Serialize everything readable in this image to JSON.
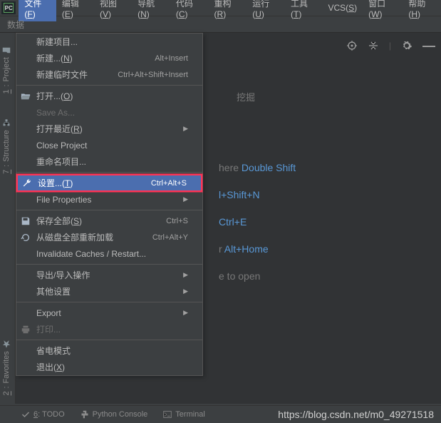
{
  "menubar": {
    "items": [
      {
        "label": "文件",
        "mn": "F"
      },
      {
        "label": "编辑",
        "mn": "E"
      },
      {
        "label": "视图",
        "mn": "V"
      },
      {
        "label": "导航",
        "mn": "N"
      },
      {
        "label": "代码",
        "mn": "C"
      },
      {
        "label": "重构",
        "mn": "R"
      },
      {
        "label": "运行",
        "mn": "U"
      },
      {
        "label": "工具",
        "mn": "T"
      },
      {
        "label": "VCS",
        "mn": "S"
      },
      {
        "label": "窗口",
        "mn": "W"
      },
      {
        "label": "帮助",
        "mn": "H"
      }
    ]
  },
  "subbar": {
    "text": "数据"
  },
  "sidetabs": {
    "project": {
      "num": "1",
      "label": "Project"
    },
    "structure": {
      "num": "7",
      "label": "Structure"
    },
    "favorites": {
      "num": "2",
      "label": "Favorites"
    }
  },
  "dropdown": {
    "items": [
      {
        "label": "新建项目...",
        "shortcut": "",
        "icon": "",
        "submenu": false
      },
      {
        "label": "新建...",
        "mn": "N",
        "shortcut": "Alt+Insert",
        "icon": "",
        "submenu": false
      },
      {
        "label": "新建临时文件",
        "shortcut": "Ctrl+Alt+Shift+Insert",
        "icon": "",
        "submenu": false
      },
      {
        "sep": true
      },
      {
        "label": "打开...",
        "mn": "O",
        "shortcut": "",
        "icon": "folder",
        "submenu": false
      },
      {
        "label": "Save As...",
        "disabled": true
      },
      {
        "label": "打开最近",
        "mn": "R",
        "shortcut": "",
        "submenu": true
      },
      {
        "label": "Close Project"
      },
      {
        "label": "重命名项目..."
      },
      {
        "sep": true
      },
      {
        "label": "设置...",
        "mn": "T",
        "shortcut": "Ctrl+Alt+S",
        "icon": "wrench",
        "highlighted": true
      },
      {
        "label": "File Properties",
        "submenu": true
      },
      {
        "sep": true
      },
      {
        "label": "保存全部",
        "mn": "S",
        "shortcut": "Ctrl+S",
        "icon": "save"
      },
      {
        "label": "从磁盘全部重新加载",
        "shortcut": "Ctrl+Alt+Y",
        "icon": "reload"
      },
      {
        "label": "Invalidate Caches / Restart..."
      },
      {
        "sep": true
      },
      {
        "label": "导出/导入操作",
        "submenu": true
      },
      {
        "label": "其他设置",
        "submenu": true
      },
      {
        "sep": true
      },
      {
        "label": "Export",
        "submenu": true
      },
      {
        "label": "打印...",
        "icon": "print",
        "disabled": true
      },
      {
        "sep": true
      },
      {
        "label": "省电模式"
      },
      {
        "label": "退出",
        "mn": "X"
      }
    ]
  },
  "editor_tip_fragment": "挖掘",
  "editor_hints": [
    {
      "pre": "here  ",
      "link": "Double Shift"
    },
    {
      "pre": "",
      "link": "l+Shift+N"
    },
    {
      "pre": "",
      "link": "Ctrl+E"
    },
    {
      "pre": "r  ",
      "link": "Alt+Home"
    },
    {
      "pre": "e to open",
      "link": ""
    }
  ],
  "footer": {
    "todo": {
      "num": "6",
      "label": "TODO"
    },
    "console": "Python Console",
    "terminal": "Terminal",
    "watermark": "https://blog.csdn.net/m0_49271518"
  }
}
